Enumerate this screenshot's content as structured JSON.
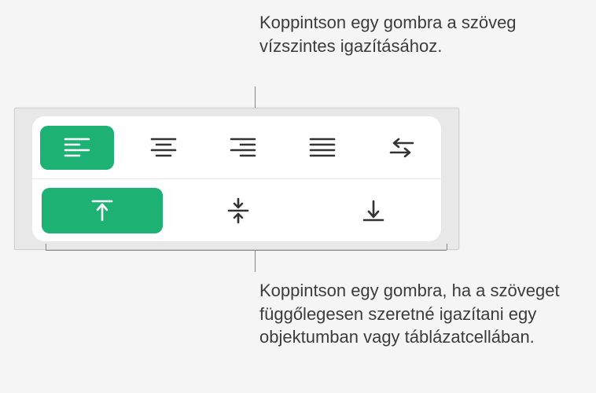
{
  "callouts": {
    "top": "Koppintson egy gombra a szöveg vízszintes igazításához.",
    "bottom": "Koppintson egy gombra, ha a szöveget függőlegesen szeretné igazítani egy objektumban vagy táblázatcellában."
  },
  "colors": {
    "selected": "#1DB273",
    "icon": "#333333",
    "iconSelected": "#FFFFFF"
  },
  "horizontal": {
    "left": {
      "selected": true
    },
    "center": {
      "selected": false
    },
    "right": {
      "selected": false
    },
    "justify": {
      "selected": false
    },
    "direction": {
      "selected": false
    }
  },
  "vertical": {
    "top": {
      "selected": true
    },
    "middle": {
      "selected": false
    },
    "bottom": {
      "selected": false
    }
  }
}
